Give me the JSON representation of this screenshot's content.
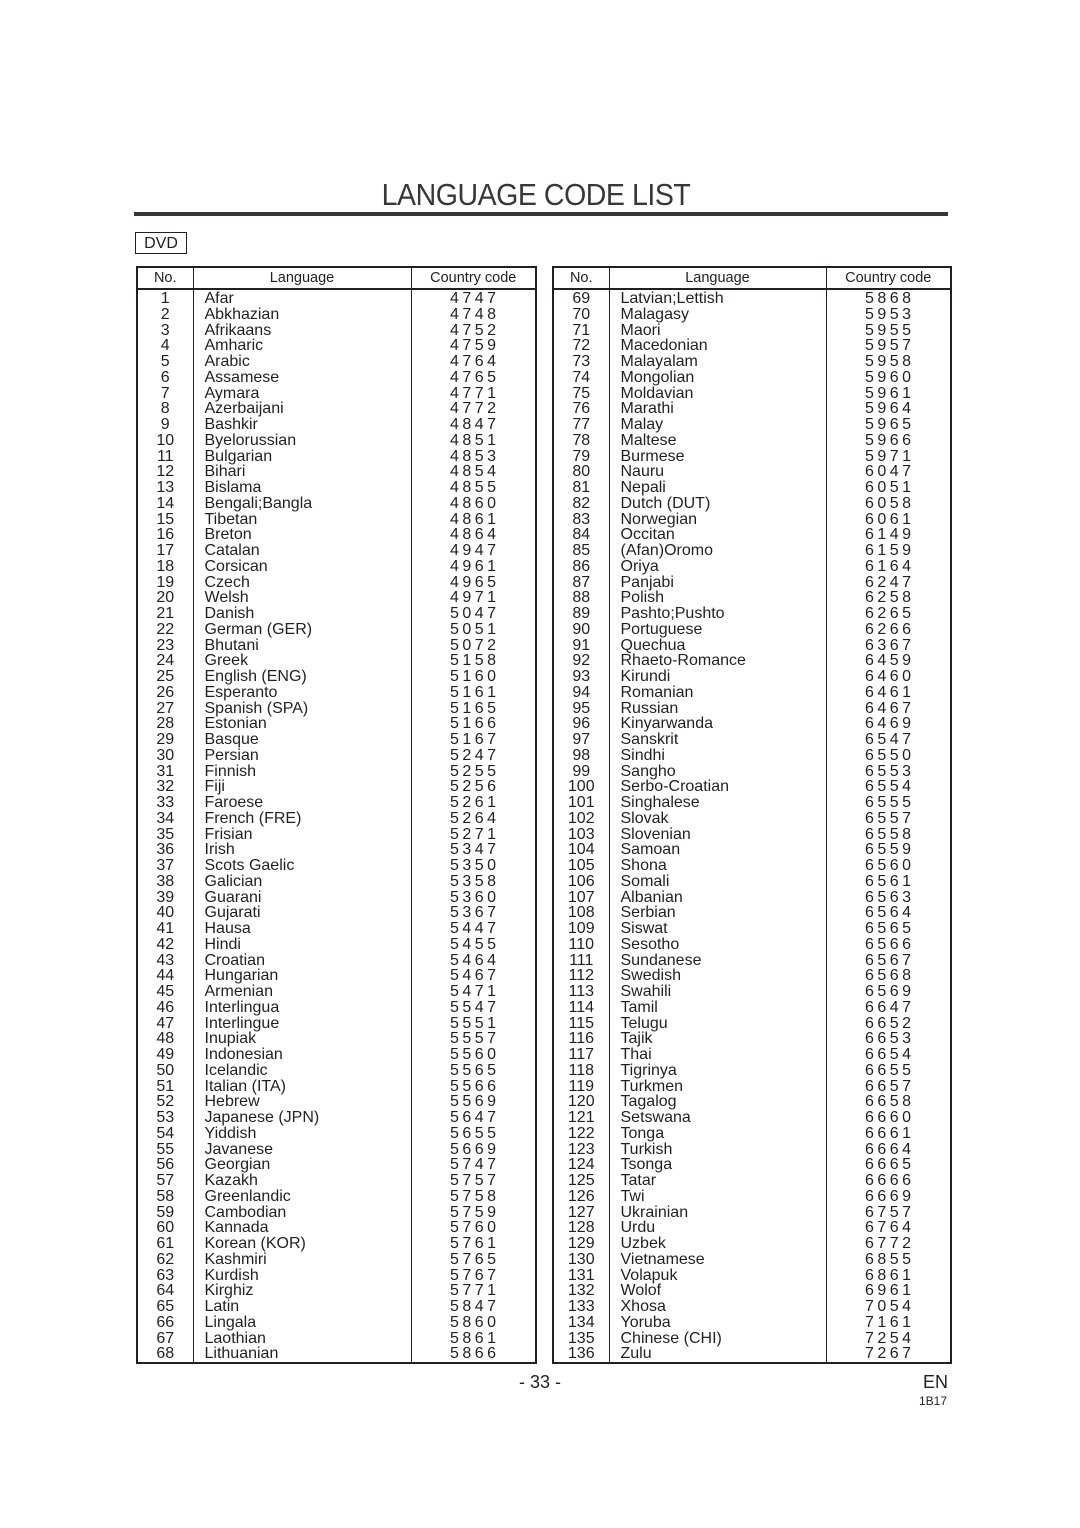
{
  "page": {
    "title": "LANGUAGE CODE LIST",
    "badge": "DVD",
    "page_number": "- 33 -",
    "language_mark": "EN",
    "doc_code": "1B17"
  },
  "table": {
    "headers": {
      "no": "No.",
      "language": "Language",
      "code": "Country code"
    },
    "left": [
      {
        "no": "1",
        "language": "Afar",
        "code": "4747"
      },
      {
        "no": "2",
        "language": "Abkhazian",
        "code": "4748"
      },
      {
        "no": "3",
        "language": "Afrikaans",
        "code": "4752"
      },
      {
        "no": "4",
        "language": "Amharic",
        "code": "4759"
      },
      {
        "no": "5",
        "language": "Arabic",
        "code": "4764"
      },
      {
        "no": "6",
        "language": "Assamese",
        "code": "4765"
      },
      {
        "no": "7",
        "language": "Aymara",
        "code": "4771"
      },
      {
        "no": "8",
        "language": "Azerbaijani",
        "code": "4772"
      },
      {
        "no": "9",
        "language": "Bashkir",
        "code": "4847"
      },
      {
        "no": "10",
        "language": "Byelorussian",
        "code": "4851"
      },
      {
        "no": "11",
        "language": "Bulgarian",
        "code": "4853"
      },
      {
        "no": "12",
        "language": "Bihari",
        "code": "4854"
      },
      {
        "no": "13",
        "language": "Bislama",
        "code": "4855"
      },
      {
        "no": "14",
        "language": "Bengali;Bangla",
        "code": "4860"
      },
      {
        "no": "15",
        "language": "Tibetan",
        "code": "4861"
      },
      {
        "no": "16",
        "language": "Breton",
        "code": "4864"
      },
      {
        "no": "17",
        "language": "Catalan",
        "code": "4947"
      },
      {
        "no": "18",
        "language": "Corsican",
        "code": "4961"
      },
      {
        "no": "19",
        "language": "Czech",
        "code": "4965"
      },
      {
        "no": "20",
        "language": "Welsh",
        "code": "4971"
      },
      {
        "no": "21",
        "language": "Danish",
        "code": "5047"
      },
      {
        "no": "22",
        "language": "German (GER)",
        "code": "5051"
      },
      {
        "no": "23",
        "language": "Bhutani",
        "code": "5072"
      },
      {
        "no": "24",
        "language": "Greek",
        "code": "5158"
      },
      {
        "no": "25",
        "language": "English (ENG)",
        "code": "5160"
      },
      {
        "no": "26",
        "language": "Esperanto",
        "code": "5161"
      },
      {
        "no": "27",
        "language": "Spanish (SPA)",
        "code": "5165"
      },
      {
        "no": "28",
        "language": "Estonian",
        "code": "5166"
      },
      {
        "no": "29",
        "language": "Basque",
        "code": "5167"
      },
      {
        "no": "30",
        "language": "Persian",
        "code": "5247"
      },
      {
        "no": "31",
        "language": "Finnish",
        "code": "5255"
      },
      {
        "no": "32",
        "language": "Fiji",
        "code": "5256"
      },
      {
        "no": "33",
        "language": "Faroese",
        "code": "5261"
      },
      {
        "no": "34",
        "language": "French (FRE)",
        "code": "5264"
      },
      {
        "no": "35",
        "language": "Frisian",
        "code": "5271"
      },
      {
        "no": "36",
        "language": "Irish",
        "code": "5347"
      },
      {
        "no": "37",
        "language": "Scots Gaelic",
        "code": "5350"
      },
      {
        "no": "38",
        "language": "Galician",
        "code": "5358"
      },
      {
        "no": "39",
        "language": "Guarani",
        "code": "5360"
      },
      {
        "no": "40",
        "language": "Gujarati",
        "code": "5367"
      },
      {
        "no": "41",
        "language": "Hausa",
        "code": "5447"
      },
      {
        "no": "42",
        "language": "Hindi",
        "code": "5455"
      },
      {
        "no": "43",
        "language": "Croatian",
        "code": "5464"
      },
      {
        "no": "44",
        "language": "Hungarian",
        "code": "5467"
      },
      {
        "no": "45",
        "language": "Armenian",
        "code": "5471"
      },
      {
        "no": "46",
        "language": "Interlingua",
        "code": "5547"
      },
      {
        "no": "47",
        "language": "Interlingue",
        "code": "5551"
      },
      {
        "no": "48",
        "language": "Inupiak",
        "code": "5557"
      },
      {
        "no": "49",
        "language": "Indonesian",
        "code": "5560"
      },
      {
        "no": "50",
        "language": "Icelandic",
        "code": "5565"
      },
      {
        "no": "51",
        "language": "Italian (ITA)",
        "code": "5566"
      },
      {
        "no": "52",
        "language": "Hebrew",
        "code": "5569"
      },
      {
        "no": "53",
        "language": "Japanese (JPN)",
        "code": "5647"
      },
      {
        "no": "54",
        "language": "Yiddish",
        "code": "5655"
      },
      {
        "no": "55",
        "language": "Javanese",
        "code": "5669"
      },
      {
        "no": "56",
        "language": "Georgian",
        "code": "5747"
      },
      {
        "no": "57",
        "language": "Kazakh",
        "code": "5757"
      },
      {
        "no": "58",
        "language": "Greenlandic",
        "code": "5758"
      },
      {
        "no": "59",
        "language": "Cambodian",
        "code": "5759"
      },
      {
        "no": "60",
        "language": "Kannada",
        "code": "5760"
      },
      {
        "no": "61",
        "language": "Korean (KOR)",
        "code": "5761"
      },
      {
        "no": "62",
        "language": "Kashmiri",
        "code": "5765"
      },
      {
        "no": "63",
        "language": "Kurdish",
        "code": "5767"
      },
      {
        "no": "64",
        "language": "Kirghiz",
        "code": "5771"
      },
      {
        "no": "65",
        "language": "Latin",
        "code": "5847"
      },
      {
        "no": "66",
        "language": "Lingala",
        "code": "5860"
      },
      {
        "no": "67",
        "language": "Laothian",
        "code": "5861"
      },
      {
        "no": "68",
        "language": "Lithuanian",
        "code": "5866"
      }
    ],
    "right": [
      {
        "no": "69",
        "language": "Latvian;Lettish",
        "code": "5868"
      },
      {
        "no": "70",
        "language": "Malagasy",
        "code": "5953"
      },
      {
        "no": "71",
        "language": "Maori",
        "code": "5955"
      },
      {
        "no": "72",
        "language": "Macedonian",
        "code": "5957"
      },
      {
        "no": "73",
        "language": "Malayalam",
        "code": "5958"
      },
      {
        "no": "74",
        "language": "Mongolian",
        "code": "5960"
      },
      {
        "no": "75",
        "language": "Moldavian",
        "code": "5961"
      },
      {
        "no": "76",
        "language": "Marathi",
        "code": "5964"
      },
      {
        "no": "77",
        "language": "Malay",
        "code": "5965"
      },
      {
        "no": "78",
        "language": "Maltese",
        "code": "5966"
      },
      {
        "no": "79",
        "language": "Burmese",
        "code": "5971"
      },
      {
        "no": "80",
        "language": "Nauru",
        "code": "6047"
      },
      {
        "no": "81",
        "language": "Nepali",
        "code": "6051"
      },
      {
        "no": "82",
        "language": "Dutch (DUT)",
        "code": "6058"
      },
      {
        "no": "83",
        "language": "Norwegian",
        "code": "6061"
      },
      {
        "no": "84",
        "language": "Occitan",
        "code": "6149"
      },
      {
        "no": "85",
        "language": "(Afan)Oromo",
        "code": "6159"
      },
      {
        "no": "86",
        "language": "Oriya",
        "code": "6164"
      },
      {
        "no": "87",
        "language": "Panjabi",
        "code": "6247"
      },
      {
        "no": "88",
        "language": "Polish",
        "code": "6258"
      },
      {
        "no": "89",
        "language": "Pashto;Pushto",
        "code": "6265"
      },
      {
        "no": "90",
        "language": "Portuguese",
        "code": "6266"
      },
      {
        "no": "91",
        "language": "Quechua",
        "code": "6367"
      },
      {
        "no": "92",
        "language": "Rhaeto-Romance",
        "code": "6459"
      },
      {
        "no": "93",
        "language": "Kirundi",
        "code": "6460"
      },
      {
        "no": "94",
        "language": "Romanian",
        "code": "6461"
      },
      {
        "no": "95",
        "language": "Russian",
        "code": "6467"
      },
      {
        "no": "96",
        "language": "Kinyarwanda",
        "code": "6469"
      },
      {
        "no": "97",
        "language": "Sanskrit",
        "code": "6547"
      },
      {
        "no": "98",
        "language": "Sindhi",
        "code": "6550"
      },
      {
        "no": "99",
        "language": "Sangho",
        "code": "6553"
      },
      {
        "no": "100",
        "language": "Serbo-Croatian",
        "code": "6554"
      },
      {
        "no": "101",
        "language": "Singhalese",
        "code": "6555"
      },
      {
        "no": "102",
        "language": "Slovak",
        "code": "6557"
      },
      {
        "no": "103",
        "language": "Slovenian",
        "code": "6558"
      },
      {
        "no": "104",
        "language": "Samoan",
        "code": "6559"
      },
      {
        "no": "105",
        "language": "Shona",
        "code": "6560"
      },
      {
        "no": "106",
        "language": "Somali",
        "code": "6561"
      },
      {
        "no": "107",
        "language": "Albanian",
        "code": "6563"
      },
      {
        "no": "108",
        "language": "Serbian",
        "code": "6564"
      },
      {
        "no": "109",
        "language": "Siswat",
        "code": "6565"
      },
      {
        "no": "110",
        "language": "Sesotho",
        "code": "6566"
      },
      {
        "no": "111",
        "language": "Sundanese",
        "code": "6567"
      },
      {
        "no": "112",
        "language": "Swedish",
        "code": "6568"
      },
      {
        "no": "113",
        "language": "Swahili",
        "code": "6569"
      },
      {
        "no": "114",
        "language": "Tamil",
        "code": "6647"
      },
      {
        "no": "115",
        "language": "Telugu",
        "code": "6652"
      },
      {
        "no": "116",
        "language": "Tajik",
        "code": "6653"
      },
      {
        "no": "117",
        "language": "Thai",
        "code": "6654"
      },
      {
        "no": "118",
        "language": "Tigrinya",
        "code": "6655"
      },
      {
        "no": "119",
        "language": "Turkmen",
        "code": "6657"
      },
      {
        "no": "120",
        "language": "Tagalog",
        "code": "6658"
      },
      {
        "no": "121",
        "language": "Setswana",
        "code": "6660"
      },
      {
        "no": "122",
        "language": "Tonga",
        "code": "6661"
      },
      {
        "no": "123",
        "language": "Turkish",
        "code": "6664"
      },
      {
        "no": "124",
        "language": "Tsonga",
        "code": "6665"
      },
      {
        "no": "125",
        "language": "Tatar",
        "code": "6666"
      },
      {
        "no": "126",
        "language": "Twi",
        "code": "6669"
      },
      {
        "no": "127",
        "language": "Ukrainian",
        "code": "6757"
      },
      {
        "no": "128",
        "language": "Urdu",
        "code": "6764"
      },
      {
        "no": "129",
        "language": "Uzbek",
        "code": "6772"
      },
      {
        "no": "130",
        "language": "Vietnamese",
        "code": "6855"
      },
      {
        "no": "131",
        "language": "Volapuk",
        "code": "6861"
      },
      {
        "no": "132",
        "language": "Wolof",
        "code": "6961"
      },
      {
        "no": "133",
        "language": "Xhosa",
        "code": "7054"
      },
      {
        "no": "134",
        "language": "Yoruba",
        "code": "7161"
      },
      {
        "no": "135",
        "language": "Chinese (CHI)",
        "code": "7254"
      },
      {
        "no": "136",
        "language": "Zulu",
        "code": "7267"
      }
    ]
  }
}
